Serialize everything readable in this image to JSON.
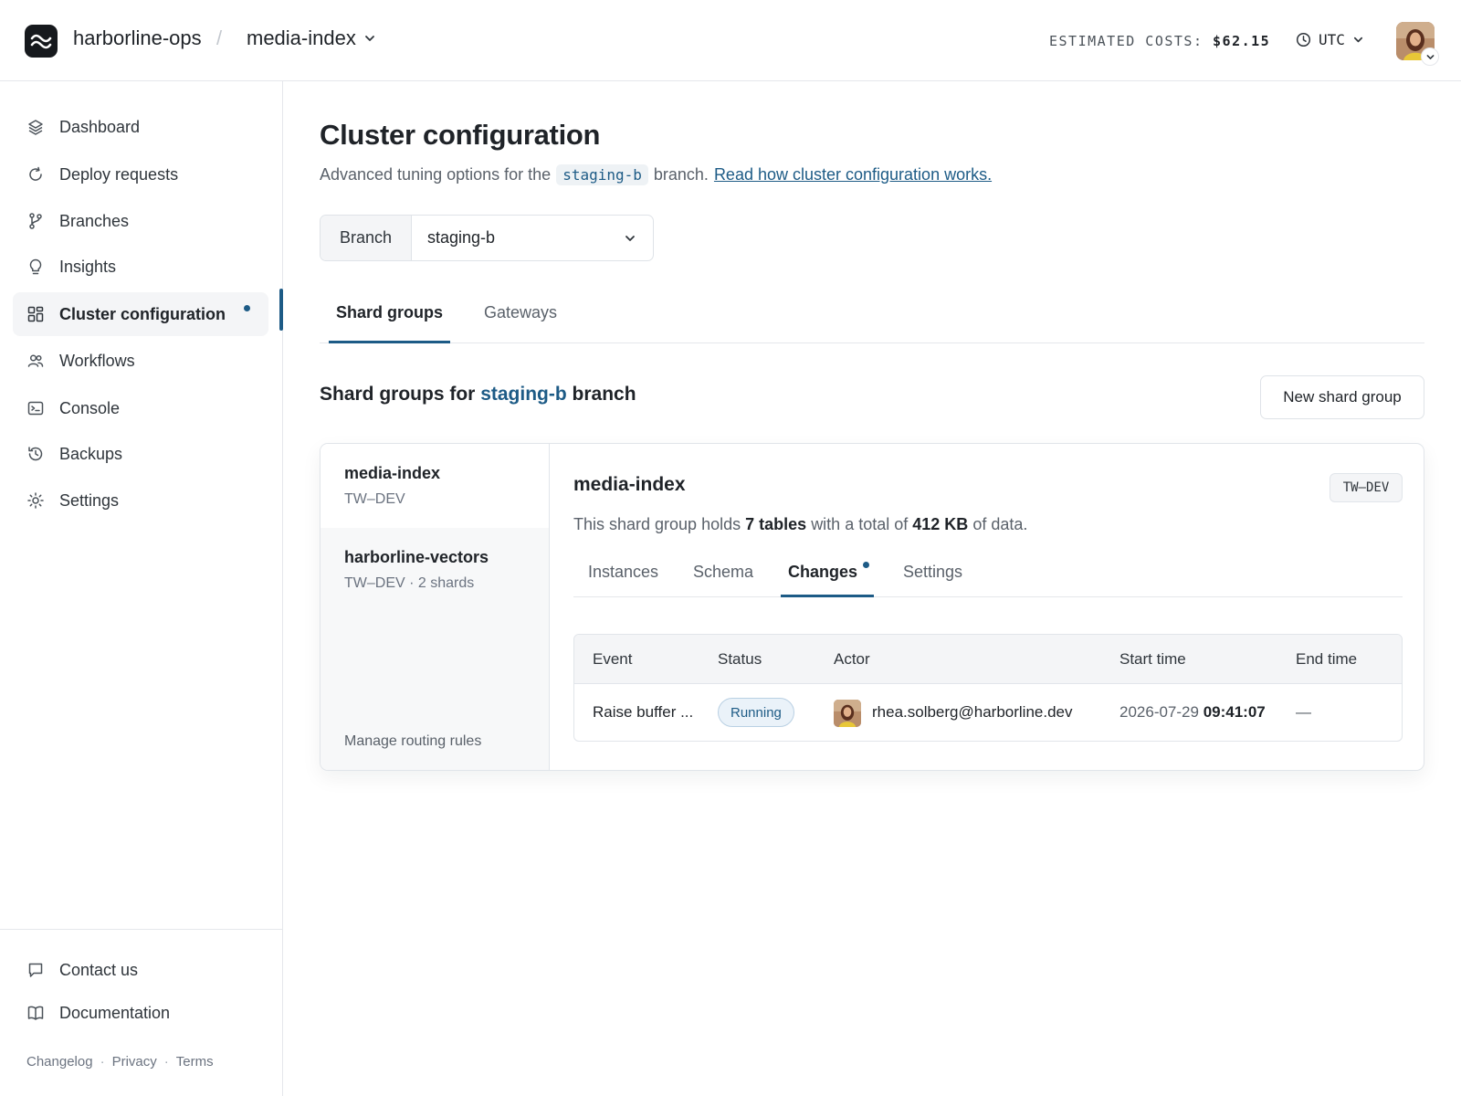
{
  "header": {
    "org": "harborline-ops",
    "separator": "/",
    "database": "media-index",
    "costs_label": "ESTIMATED COSTS:",
    "costs_value": "$62.15",
    "timezone": "UTC"
  },
  "sidebar": {
    "items": [
      {
        "label": "Dashboard",
        "icon": "layers-icon"
      },
      {
        "label": "Deploy requests",
        "icon": "refresh-icon"
      },
      {
        "label": "Branches",
        "icon": "branch-icon"
      },
      {
        "label": "Insights",
        "icon": "lightbulb-icon"
      },
      {
        "label": "Cluster configuration",
        "icon": "grid-icon",
        "active": true
      },
      {
        "label": "Workflows",
        "icon": "users-icon"
      },
      {
        "label": "Console",
        "icon": "terminal-icon"
      },
      {
        "label": "Backups",
        "icon": "history-icon"
      },
      {
        "label": "Settings",
        "icon": "gear-icon"
      }
    ],
    "bottom": [
      {
        "label": "Contact us",
        "icon": "chat-icon"
      },
      {
        "label": "Documentation",
        "icon": "book-icon"
      }
    ],
    "footer_links": [
      "Changelog",
      "Privacy",
      "Terms"
    ],
    "footer_sep": "·"
  },
  "page": {
    "title": "Cluster configuration",
    "subtitle_prefix": "Advanced tuning options for the",
    "subtitle_branch": "staging-b",
    "subtitle_suffix": "branch.",
    "subtitle_link": "Read how cluster configuration works."
  },
  "branch_select": {
    "label": "Branch",
    "value": "staging-b"
  },
  "tabs": [
    "Shard groups",
    "Gateways"
  ],
  "section": {
    "prefix": "Shard groups for",
    "branch": "staging-b",
    "suffix": "branch",
    "new_button": "New shard group"
  },
  "shard_groups": [
    {
      "name": "media-index",
      "meta": "TW–DEV"
    },
    {
      "name": "harborline-vectors",
      "meta": "TW–DEV · 2 shards"
    }
  ],
  "routing_link": "Manage routing rules",
  "detail": {
    "title": "media-index",
    "env_badge": "TW–DEV",
    "desc_prefix": "This shard group holds",
    "desc_tables": "7 tables",
    "desc_mid": "with a total of",
    "desc_size": "412 KB",
    "desc_suffix": "of data.",
    "tabs": [
      "Instances",
      "Schema",
      "Changes",
      "Settings"
    ]
  },
  "changes_table": {
    "columns": [
      "Event",
      "Status",
      "Actor",
      "Start time",
      "End time"
    ],
    "rows": [
      {
        "event": "Raise buffer ...",
        "status": "Running",
        "actor": "rhea.solberg@harborline.dev",
        "start_date": "2026-07-29",
        "start_time": "09:41:07",
        "end_time": "—"
      }
    ]
  },
  "colors": {
    "accent": "#1d5b86",
    "status_running_bg": "#eaf2f9",
    "border": "#e1e5ea"
  }
}
